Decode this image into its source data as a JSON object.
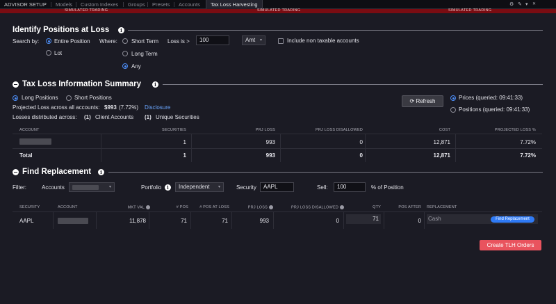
{
  "topbar": {
    "tabs": [
      "ADVISOR SETUP",
      "Models",
      "Custom Indexes",
      "Groups",
      "Presets",
      "Accounts",
      "Tax Loss Harvesting"
    ],
    "active_tab": "Tax Loss Harvesting",
    "banner": "SIMULATED TRADING",
    "icons": [
      "gear-icon",
      "pin-icon",
      "chevron-down-icon",
      "close-icon"
    ]
  },
  "identify": {
    "title": "Identify Positions at Loss",
    "search_by_label": "Search by:",
    "search_options": [
      "Entire Position",
      "Lot"
    ],
    "search_selected": "Entire Position",
    "where_label": "Where:",
    "where_options": [
      "Short Term",
      "Long Term",
      "Any"
    ],
    "where_selected": "Any",
    "loss_label": "Loss is >",
    "loss_value": "100",
    "loss_unit": "Amt",
    "non_taxable_label": "Include non taxable accounts"
  },
  "summary": {
    "title": "Tax Loss Information Summary",
    "position_options": [
      "Long Positions",
      "Short Positions"
    ],
    "position_selected": "Long Positions",
    "projected_label": "Projected Loss across all accounts:",
    "projected_value": "$993",
    "projected_pct": "(7.72%)",
    "disclosure_link": "Disclosure",
    "distributed_label": "Losses distributed across:",
    "client_count": "(1)",
    "client_label": "Client Accounts",
    "unique_count": "(1)",
    "unique_label": "Unique Securities",
    "refresh_label": "Refresh",
    "prices_label": "Prices (queried: 09:41:33)",
    "positions_label": "Positions (queried: 09:41:33)",
    "table": {
      "headers": [
        "ACCOUNT",
        "SECURITIES",
        "PRJ LOSS",
        "PRJ LOSS DISALLOWED",
        "COST",
        "PROJECTED LOSS %"
      ],
      "row": [
        "",
        "1",
        "993",
        "0",
        "12,871",
        "7.72%"
      ],
      "total": [
        "Total",
        "1",
        "993",
        "0",
        "12,871",
        "7.72%"
      ]
    }
  },
  "replacement": {
    "title": "Find Replacement",
    "filter_label": "Filter:",
    "accounts_label": "Accounts",
    "portfolio_label": "Portfolio",
    "portfolio_value": "Independent",
    "security_label": "Security",
    "security_value": "AAPL",
    "sell_label": "Sell:",
    "sell_value": "100",
    "sell_suffix": "% of Position",
    "table": {
      "headers": [
        "SECURITY",
        "ACCOUNT",
        "MKT VAL",
        "# POS",
        "# POS AT LOSS",
        "PRJ LOSS",
        "PRJ LOSS DISALLOWED",
        "QTY",
        "POS AFTER",
        "REPLACEMENT"
      ],
      "row": {
        "security": "AAPL",
        "mkt_val": "11,878",
        "pos": "71",
        "pos_at_loss": "71",
        "prj_loss": "993",
        "prj_loss_disallowed": "0",
        "qty": "71",
        "pos_after": "0",
        "replacement": "Cash",
        "find_btn": "Find Replacement"
      }
    },
    "create_btn": "Create TLH Orders"
  },
  "colors": {
    "background": "#1b1b24",
    "accent_blue": "#2f7af5",
    "danger_red": "#e9535e",
    "banner_red": "#7a0c12"
  }
}
